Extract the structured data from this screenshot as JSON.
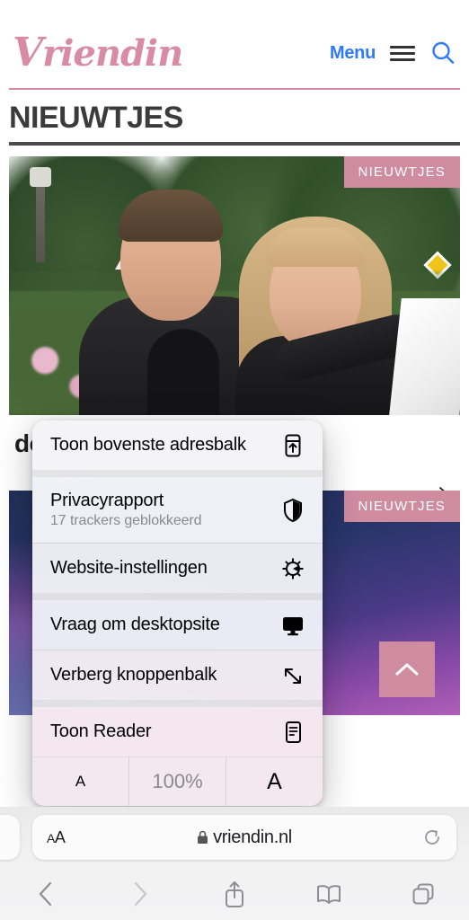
{
  "site": {
    "brand": "Vriendin",
    "brand_first_letter": "V",
    "brand_rest": "riendin",
    "menu_label": "Menu",
    "search_icon": "search-icon",
    "hamburger_icon": "hamburger-icon",
    "accent_pink": "#d98ba3",
    "menu_blue": "#2f7af7"
  },
  "section": {
    "title": "NIEUWTJES"
  },
  "articles": [
    {
      "badge": "NIEUWTJES",
      "headline": "door",
      "chevron": "chevron-right-icon",
      "image_alt": "smiling-couple-in-garden"
    },
    {
      "badge": "NIEUWTJES",
      "image_alt": "dark-blue-purple-gradient",
      "scroll_top_icon": "chevron-up-icon"
    }
  ],
  "safari_menu": {
    "items": [
      {
        "label": "Toon bovenste adresbalk",
        "sub": null,
        "icon": "address-bar-top-icon"
      },
      {
        "label": "Privacyrapport",
        "sub": "17 trackers geblokkeerd",
        "icon": "shield-icon"
      },
      {
        "label": "Website-instellingen",
        "sub": null,
        "icon": "gear-icon"
      },
      {
        "label": "Vraag om desktopsite",
        "sub": null,
        "icon": "desktop-monitor-icon"
      },
      {
        "label": "Verberg knoppenbalk",
        "sub": null,
        "icon": "expand-diagonal-icon"
      },
      {
        "label": "Toon Reader",
        "sub": null,
        "icon": "reader-document-icon"
      }
    ],
    "zoom": {
      "decrease_label": "A",
      "level": "100%",
      "increase_label": "A"
    }
  },
  "browser": {
    "address": {
      "text_size_button": "AA",
      "text_size_small": "A",
      "text_size_large": "A",
      "url": "vriendin.nl",
      "lock_icon": "lock-icon",
      "reload_icon": "reload-icon"
    },
    "toolbar": [
      {
        "name": "back-button",
        "icon": "chevron-left-icon",
        "enabled": true
      },
      {
        "name": "forward-button",
        "icon": "chevron-right-icon",
        "enabled": false
      },
      {
        "name": "share-button",
        "icon": "share-icon",
        "enabled": true
      },
      {
        "name": "bookmarks-button",
        "icon": "book-icon",
        "enabled": true
      },
      {
        "name": "tabs-button",
        "icon": "tabs-icon",
        "enabled": true
      }
    ]
  }
}
